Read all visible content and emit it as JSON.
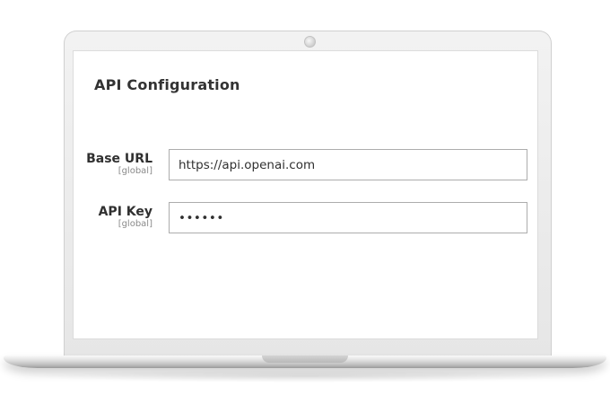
{
  "config": {
    "title": "API Configuration",
    "fields": [
      {
        "label": "Base URL",
        "scope": "[global]",
        "value": "https://api.openai.com"
      },
      {
        "label": "API Key",
        "scope": "[global]",
        "value": "••••••"
      }
    ]
  }
}
